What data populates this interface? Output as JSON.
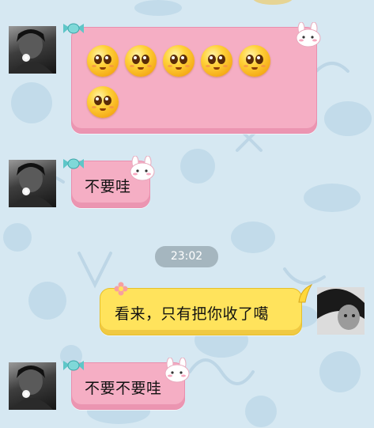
{
  "conversation": {
    "messages": [
      {
        "side": "left",
        "type": "emoji",
        "emoji_name": "teary-eyed-face-emoji",
        "emoji_count": 6
      },
      {
        "side": "left",
        "type": "text",
        "text": "不要哇"
      },
      {
        "side": "center",
        "type": "timestamp",
        "text": "23:02"
      },
      {
        "side": "right",
        "type": "text",
        "text": "看来，只有把你收了噶"
      },
      {
        "side": "left",
        "type": "text",
        "text": "不要不要哇"
      }
    ]
  },
  "colors": {
    "background": "#d6e8f2",
    "incoming_bubble": "#f5aec4",
    "outgoing_bubble": "#ffe35c",
    "timestamp_pill": "#7d8c96"
  },
  "icons": {
    "incoming_decoration": "bunny-icon",
    "incoming_clip": "candy-icon",
    "outgoing_decoration": "flower-icon"
  }
}
